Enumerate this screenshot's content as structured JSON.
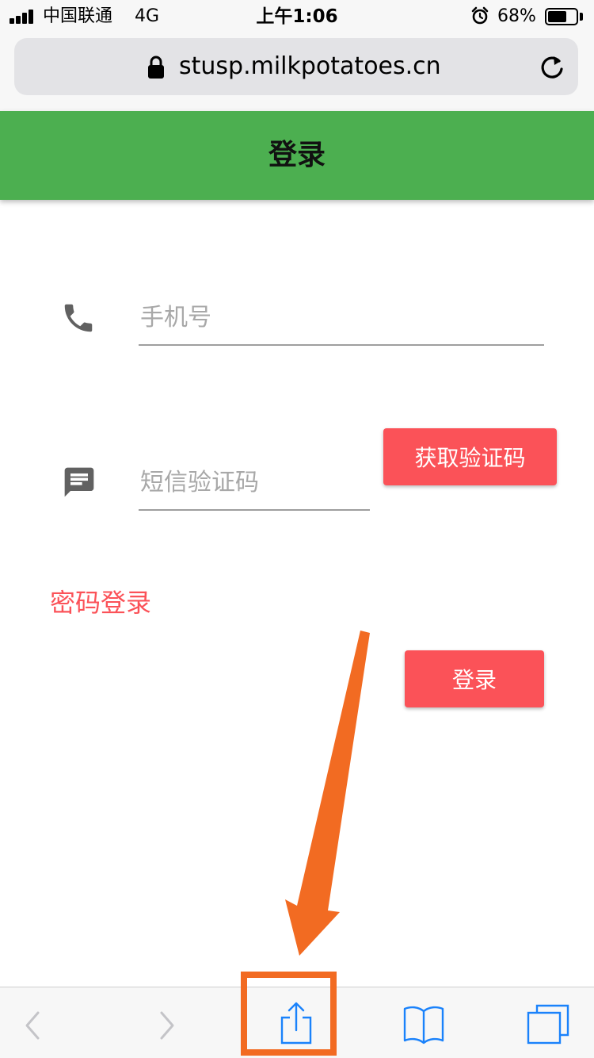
{
  "status_bar": {
    "carrier": "中国联通",
    "network": "4G",
    "time": "上午1:06",
    "battery_percent": "68%",
    "battery_level": 0.68
  },
  "browser": {
    "url": "stusp.milkpotatoes.cn"
  },
  "header": {
    "title": "登录"
  },
  "form": {
    "phone_placeholder": "手机号",
    "sms_placeholder": "短信验证码",
    "get_code_label": "获取验证码",
    "password_login_label": "密码登录",
    "login_label": "登录"
  },
  "colors": {
    "header": "#4caf50",
    "accent": "#fb5258",
    "annotation": "#f26b22",
    "toolbar_icon": "#1a82fb"
  },
  "icons": {
    "lock": "lock-icon",
    "reload": "reload-icon",
    "phone": "phone-icon",
    "sms": "sms-icon",
    "back": "chevron-left-icon",
    "forward": "chevron-right-icon",
    "share": "share-icon",
    "bookmarks": "book-icon",
    "tabs": "tabs-icon"
  }
}
